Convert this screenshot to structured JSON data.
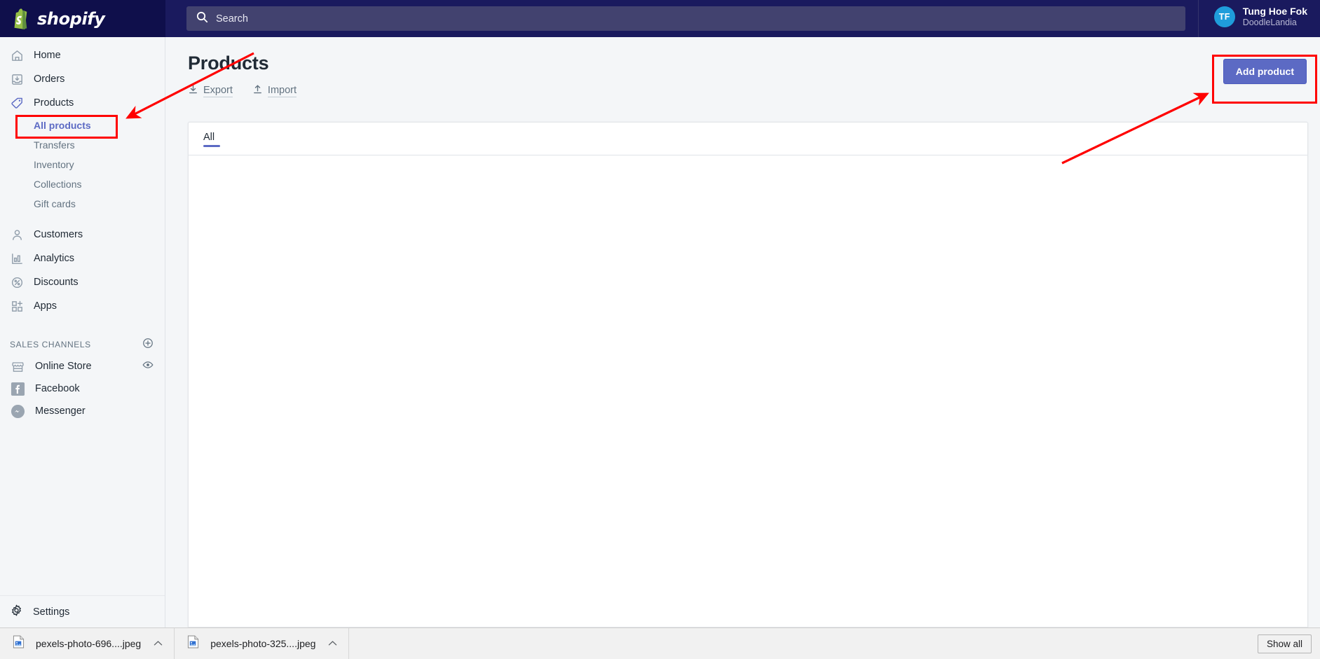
{
  "topbar": {
    "brand": "shopify",
    "brand_icon": "shopify-bag-icon",
    "search": {
      "icon": "search-icon",
      "placeholder": "Search",
      "value": ""
    },
    "user": {
      "initials": "TF",
      "name": "Tung Hoe Fok",
      "store": "DoodleLandia"
    }
  },
  "sidebar": {
    "items": [
      {
        "label": "Home",
        "icon": "home-icon",
        "active": false
      },
      {
        "label": "Orders",
        "icon": "orders-inbox-icon",
        "active": false
      },
      {
        "label": "Products",
        "icon": "products-tag-icon",
        "active": true
      }
    ],
    "product_subitems": [
      {
        "label": "All products",
        "selected": true
      },
      {
        "label": "Transfers",
        "selected": false
      },
      {
        "label": "Inventory",
        "selected": false
      },
      {
        "label": "Collections",
        "selected": false
      },
      {
        "label": "Gift cards",
        "selected": false
      }
    ],
    "items_after": [
      {
        "label": "Customers",
        "icon": "customer-person-icon"
      },
      {
        "label": "Analytics",
        "icon": "analytics-bars-icon"
      },
      {
        "label": "Discounts",
        "icon": "discount-percent-icon"
      },
      {
        "label": "Apps",
        "icon": "apps-grid-plus-icon"
      }
    ],
    "sales_channels": {
      "title": "SALES CHANNELS",
      "add_icon": "plus-circle-icon",
      "channels": [
        {
          "label": "Online Store",
          "icon": "storefront-icon",
          "trailing_icon": "eye-icon"
        },
        {
          "label": "Facebook",
          "icon": "facebook-icon",
          "trailing_icon": ""
        },
        {
          "label": "Messenger",
          "icon": "messenger-icon",
          "trailing_icon": ""
        }
      ]
    },
    "settings": {
      "label": "Settings",
      "icon": "gear-icon"
    }
  },
  "main": {
    "title": "Products",
    "export": {
      "label": "Export",
      "icon": "download-arrow-icon"
    },
    "import": {
      "label": "Import",
      "icon": "upload-arrow-icon"
    },
    "add_product_label": "Add product",
    "tabs": [
      {
        "label": "All",
        "active": true
      }
    ]
  },
  "downloads": {
    "items": [
      {
        "name": "pexels-photo-696....jpeg",
        "icon": "image-file-icon",
        "caret": "chevron-up-icon"
      },
      {
        "name": "pexels-photo-325....jpeg",
        "icon": "image-file-icon",
        "caret": "chevron-up-icon"
      }
    ],
    "show_all_label": "Show all"
  },
  "annotations": {
    "highlight_color": "#ff0000",
    "boxes": [
      {
        "name": "all-products-highlight"
      },
      {
        "name": "add-product-highlight"
      }
    ],
    "arrows": [
      {
        "name": "arrow-to-all-products"
      },
      {
        "name": "arrow-to-add-product"
      }
    ]
  },
  "theme": {
    "topbar_bg": "#1a1a5e",
    "logo_bg": "#0f0f4b",
    "search_bg": "#42426f",
    "sidebar_bg": "#f4f6f8",
    "accent": "#5c6ac4",
    "avatar_bg": "#1f9ddb",
    "text": "#212b36",
    "muted_text": "#637381"
  }
}
